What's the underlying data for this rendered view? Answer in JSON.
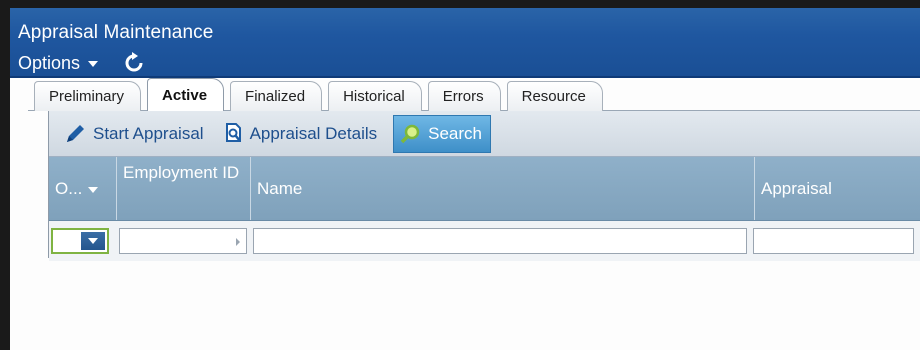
{
  "window": {
    "title": "Appraisal Maintenance"
  },
  "menubar": {
    "options_label": "Options",
    "options_icon": "chevron-down-icon",
    "refresh_icon": "refresh-icon"
  },
  "tabs": [
    {
      "label": "Preliminary",
      "active": false
    },
    {
      "label": "Active",
      "active": true
    },
    {
      "label": "Finalized",
      "active": false
    },
    {
      "label": "Historical",
      "active": false
    },
    {
      "label": "Errors",
      "active": false
    },
    {
      "label": "Resource",
      "active": false
    }
  ],
  "toolbar": {
    "start_label": "Start Appraisal",
    "start_icon": "pencil-icon",
    "details_label": "Appraisal Details",
    "details_icon": "document-search-icon",
    "search_label": "Search",
    "search_icon": "magnifier-icon"
  },
  "grid": {
    "columns": [
      {
        "label": "O..."
      },
      {
        "label": "Employment ID"
      },
      {
        "label": "Name"
      },
      {
        "label": "Appraisal"
      }
    ]
  },
  "colors": {
    "titlebar": "#1f57a0",
    "grid_header": "#86a7c0",
    "search_button": "#4e9fd4",
    "filter_focus": "#7fb342"
  }
}
